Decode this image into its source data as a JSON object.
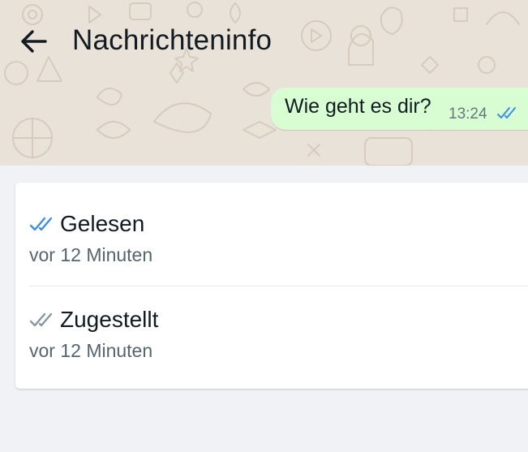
{
  "header": {
    "title": "Nachrichteninfo",
    "back_icon": "arrow-left-icon"
  },
  "message": {
    "text": "Wie geht es dir?",
    "time": "13:24",
    "status_icon": "double-check-icon",
    "bubble_color": "#d9fdd3"
  },
  "statuses": {
    "read": {
      "label": "Gelesen",
      "time": "vor 12 Minuten",
      "icon": "double-check-icon",
      "icon_color": "#53bdeb"
    },
    "delivered": {
      "label": "Zugestellt",
      "time": "vor 12 Minuten",
      "icon": "double-check-icon",
      "icon_color": "#8696a0"
    }
  },
  "colors": {
    "read_tick": "#3a8ee6",
    "delivered_tick": "#8696a0",
    "wallpaper": "#e9e2d8",
    "page_bg": "#f0f2f5"
  }
}
